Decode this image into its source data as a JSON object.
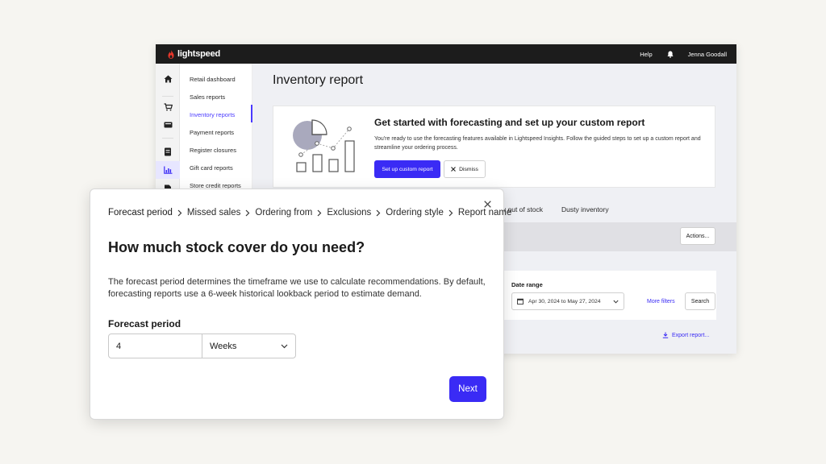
{
  "brand": {
    "name": "lightspeed",
    "accent": "#3a2bf5",
    "flame_color": "#e8372b"
  },
  "topbar": {
    "help_label": "Help",
    "bell_icon": "bell-icon",
    "user_name": "Jenna Goodall"
  },
  "rail_icons": [
    "home-icon",
    "cart-icon",
    "register-icon",
    "receipt-icon",
    "chart-icon",
    "document-icon"
  ],
  "subnav": {
    "items": [
      {
        "label": "Retail dashboard"
      },
      {
        "label": "Sales reports"
      },
      {
        "label": "Inventory reports",
        "active": true
      },
      {
        "label": "Payment reports"
      },
      {
        "label": "Register closures"
      },
      {
        "label": "Gift card reports"
      },
      {
        "label": "Store credit reports"
      }
    ]
  },
  "page": {
    "title": "Inventory report"
  },
  "promo": {
    "heading": "Get started with forecasting and set up your custom report",
    "body": "You're ready to use the forecasting features available in Lightspeed Insights. Follow the guided steps to set up a custom report and streamline your ordering process.",
    "primary_label": "Set up custom report",
    "dismiss_label": "Dismiss"
  },
  "report_tabs": [
    "ly out of stock",
    "Dusty inventory"
  ],
  "actions_label": "Actions...",
  "filters": {
    "date_range_label": "Date range",
    "date_range_value": "Apr 30, 2024 to May 27, 2024",
    "more_filters_label": "More filters",
    "search_label": "Search"
  },
  "export_label": "Export report...",
  "modal": {
    "steps": [
      "Forecast period",
      "Missed sales",
      "Ordering from",
      "Exclusions",
      "Ordering style",
      "Report name"
    ],
    "current_step": 0,
    "title": "How much stock cover do you need?",
    "description": "The forecast period determines the timeframe we use to calculate recommendations. By default, forecasting reports use a 6-week historical lookback period to estimate demand.",
    "field_label": "Forecast period",
    "period_value": "4",
    "period_unit": "Weeks",
    "next_label": "Next"
  }
}
